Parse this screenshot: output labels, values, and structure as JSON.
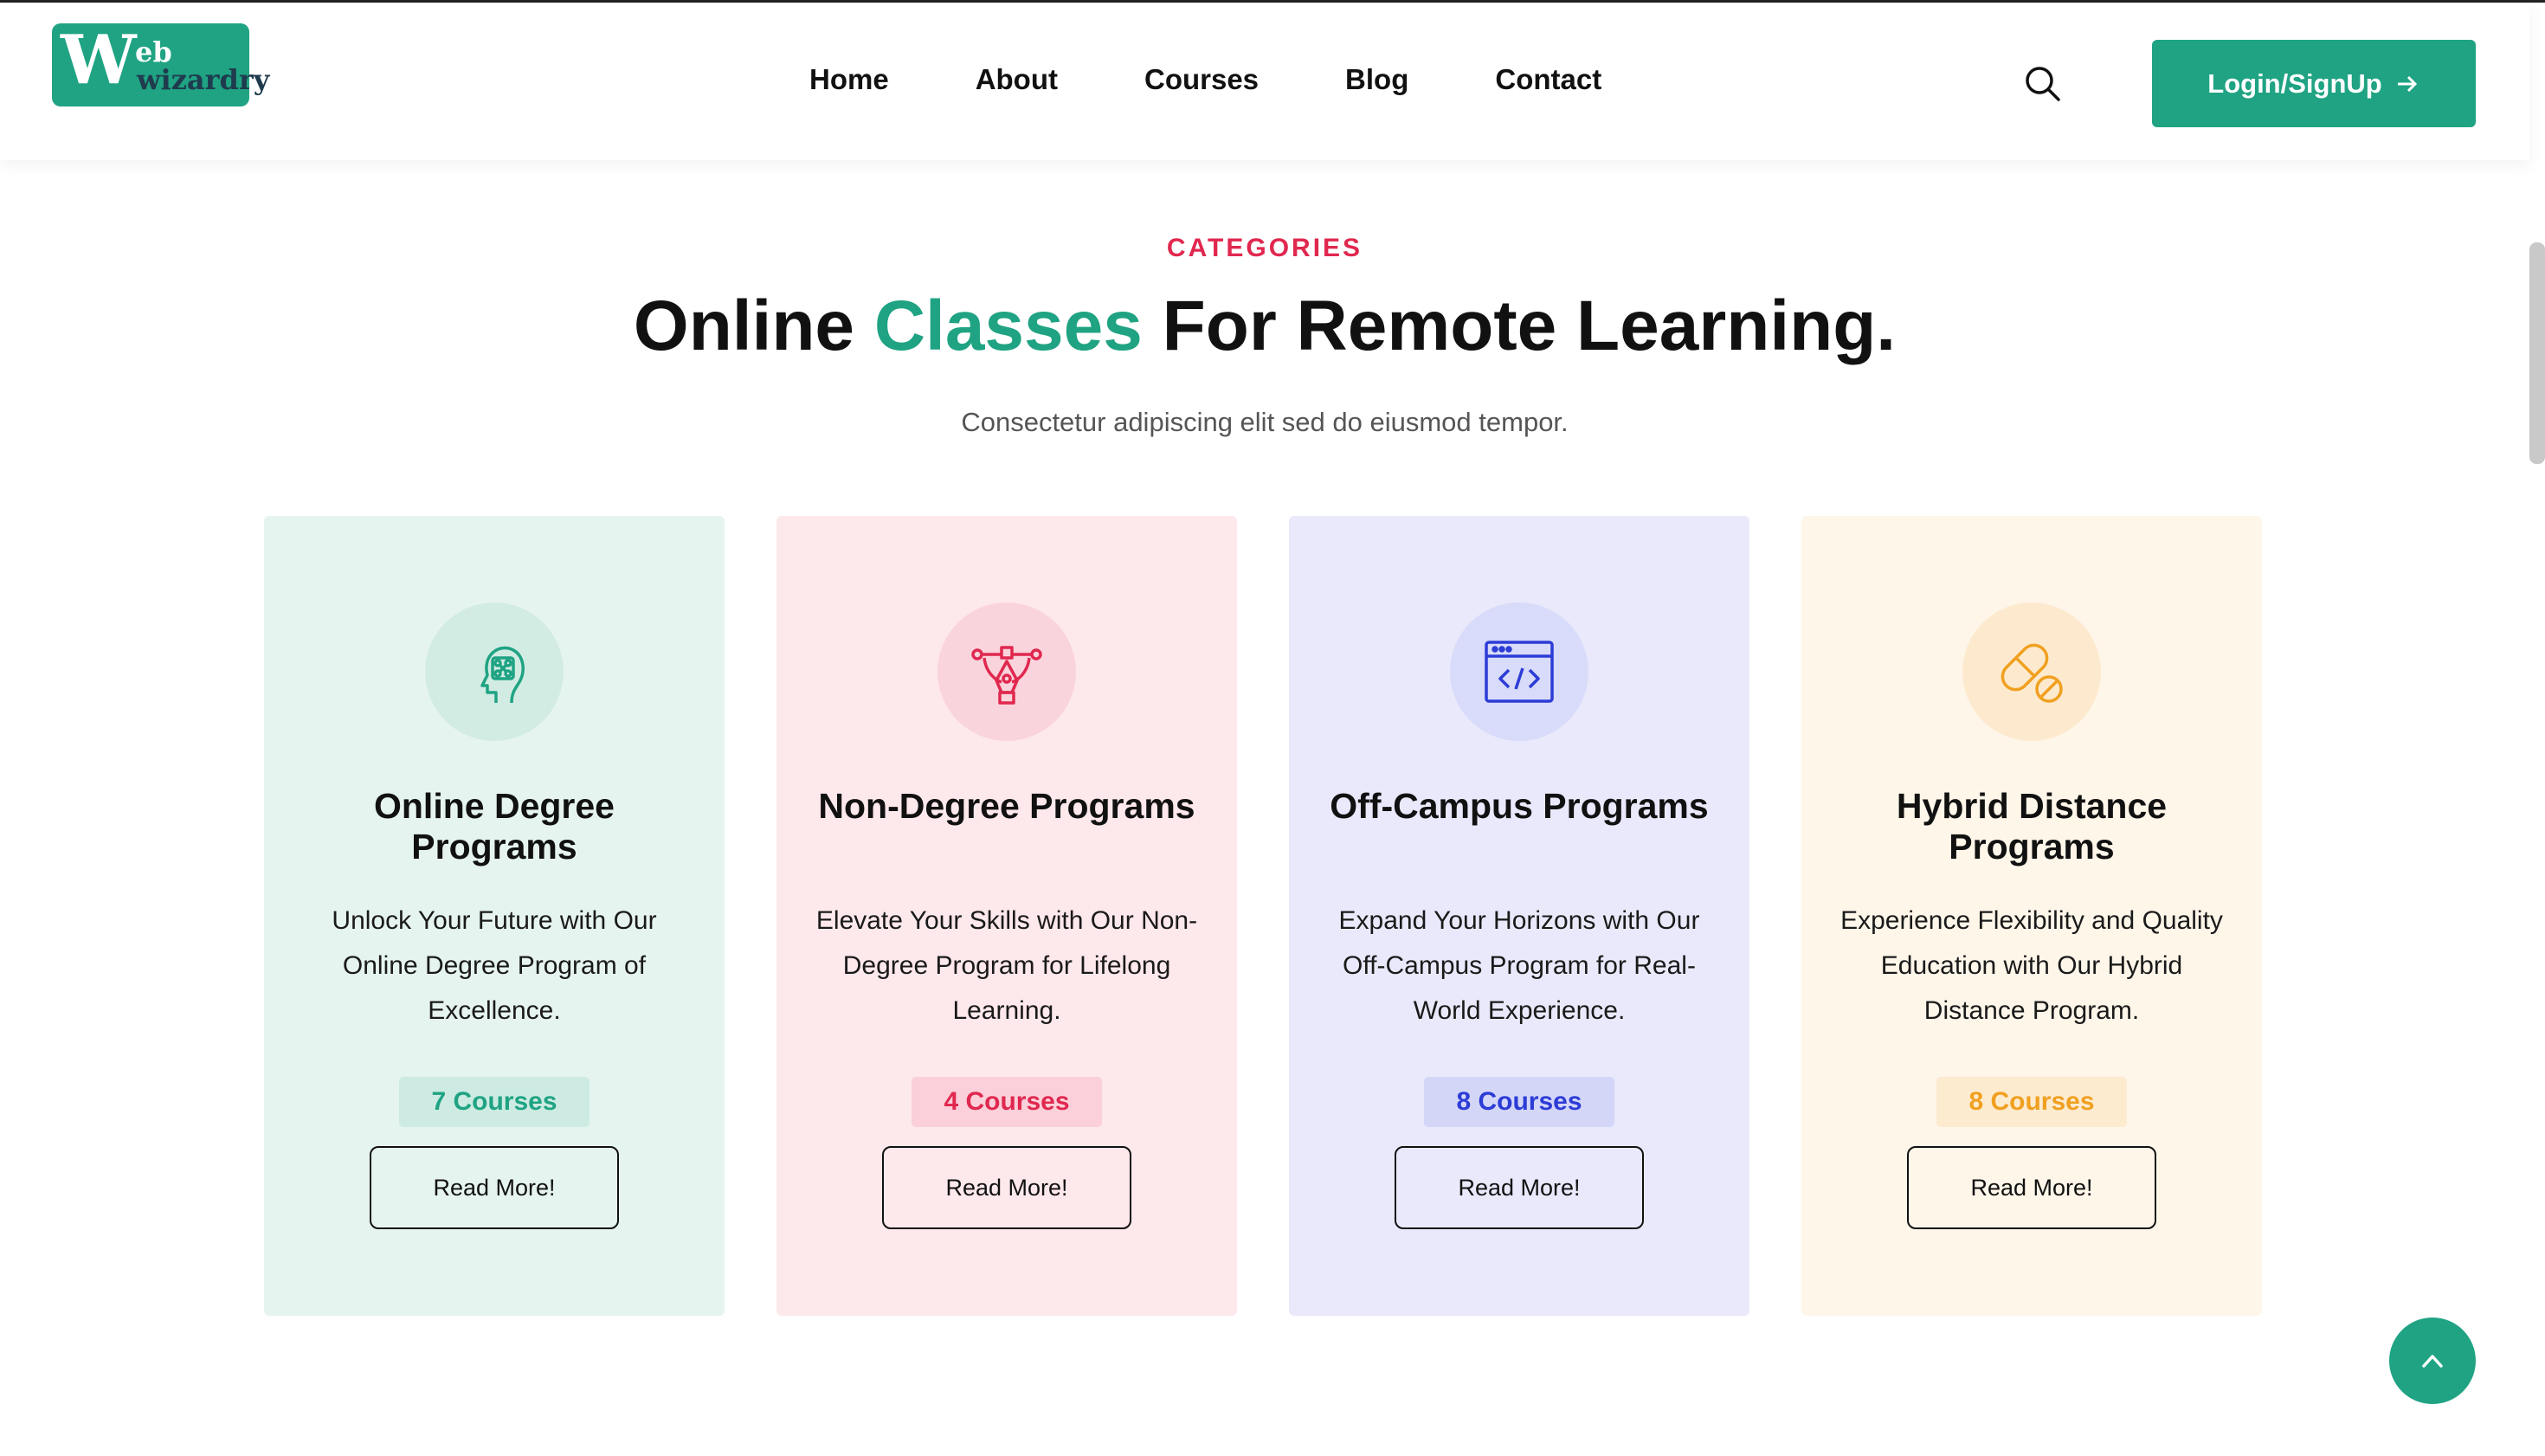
{
  "header": {
    "logo": {
      "big_letter": "W",
      "top": "eb",
      "bottom": "wizardry"
    },
    "nav": [
      "Home",
      "About",
      "Courses",
      "Blog",
      "Contact"
    ],
    "login_label": "Login/SignUp"
  },
  "section": {
    "eyebrow": "CATEGORIES",
    "title_pre": "Online ",
    "title_accent": "Classes",
    "title_post": " For Remote Learning.",
    "subtitle": "Consectetur adipiscing elit sed do eiusmod tempor."
  },
  "cards": [
    {
      "title": "Online Degree Programs",
      "desc": "Unlock Your Future with Our Online Degree Program of Excellence.",
      "badge": "7 Courses",
      "button": "Read More!",
      "icon": "brain-head-icon",
      "bg": "#e6f4f0",
      "accent": "#1fa383",
      "badge_bg": "#cdebe2",
      "icon_bg": "#d2ece4"
    },
    {
      "title": "Non-Degree Programs",
      "desc": "Elevate Your Skills with Our Non-Degree Program for Lifelong Learning.",
      "badge": "4 Courses",
      "button": "Read More!",
      "icon": "pen-tool-icon",
      "bg": "#fde8ec",
      "accent": "#e0284f",
      "badge_bg": "#fbd0da",
      "icon_bg": "#fad4dc"
    },
    {
      "title": "Off-Campus Programs",
      "desc": "Expand Your Horizons with Our Off-Campus Program for Real-World Experience.",
      "badge": "8 Courses",
      "button": "Read More!",
      "icon": "code-window-icon",
      "bg": "#e9e9fb",
      "accent": "#2c3cd6",
      "badge_bg": "#d4d6f8",
      "icon_bg": "#d8dbf9"
    },
    {
      "title": "Hybrid Distance Programs",
      "desc": "Experience Flexibility and Quality Education with Our Hybrid Distance Program.",
      "badge": "8 Courses",
      "button": "Read More!",
      "icon": "pill-icon",
      "bg": "#fef6e9",
      "accent": "#f0a020",
      "badge_bg": "#fdebd0",
      "icon_bg": "#fdeace"
    }
  ],
  "icons": {
    "search": "search-icon",
    "login_arrow": "arrow-right-icon",
    "back_to_top": "chevron-up-icon"
  }
}
